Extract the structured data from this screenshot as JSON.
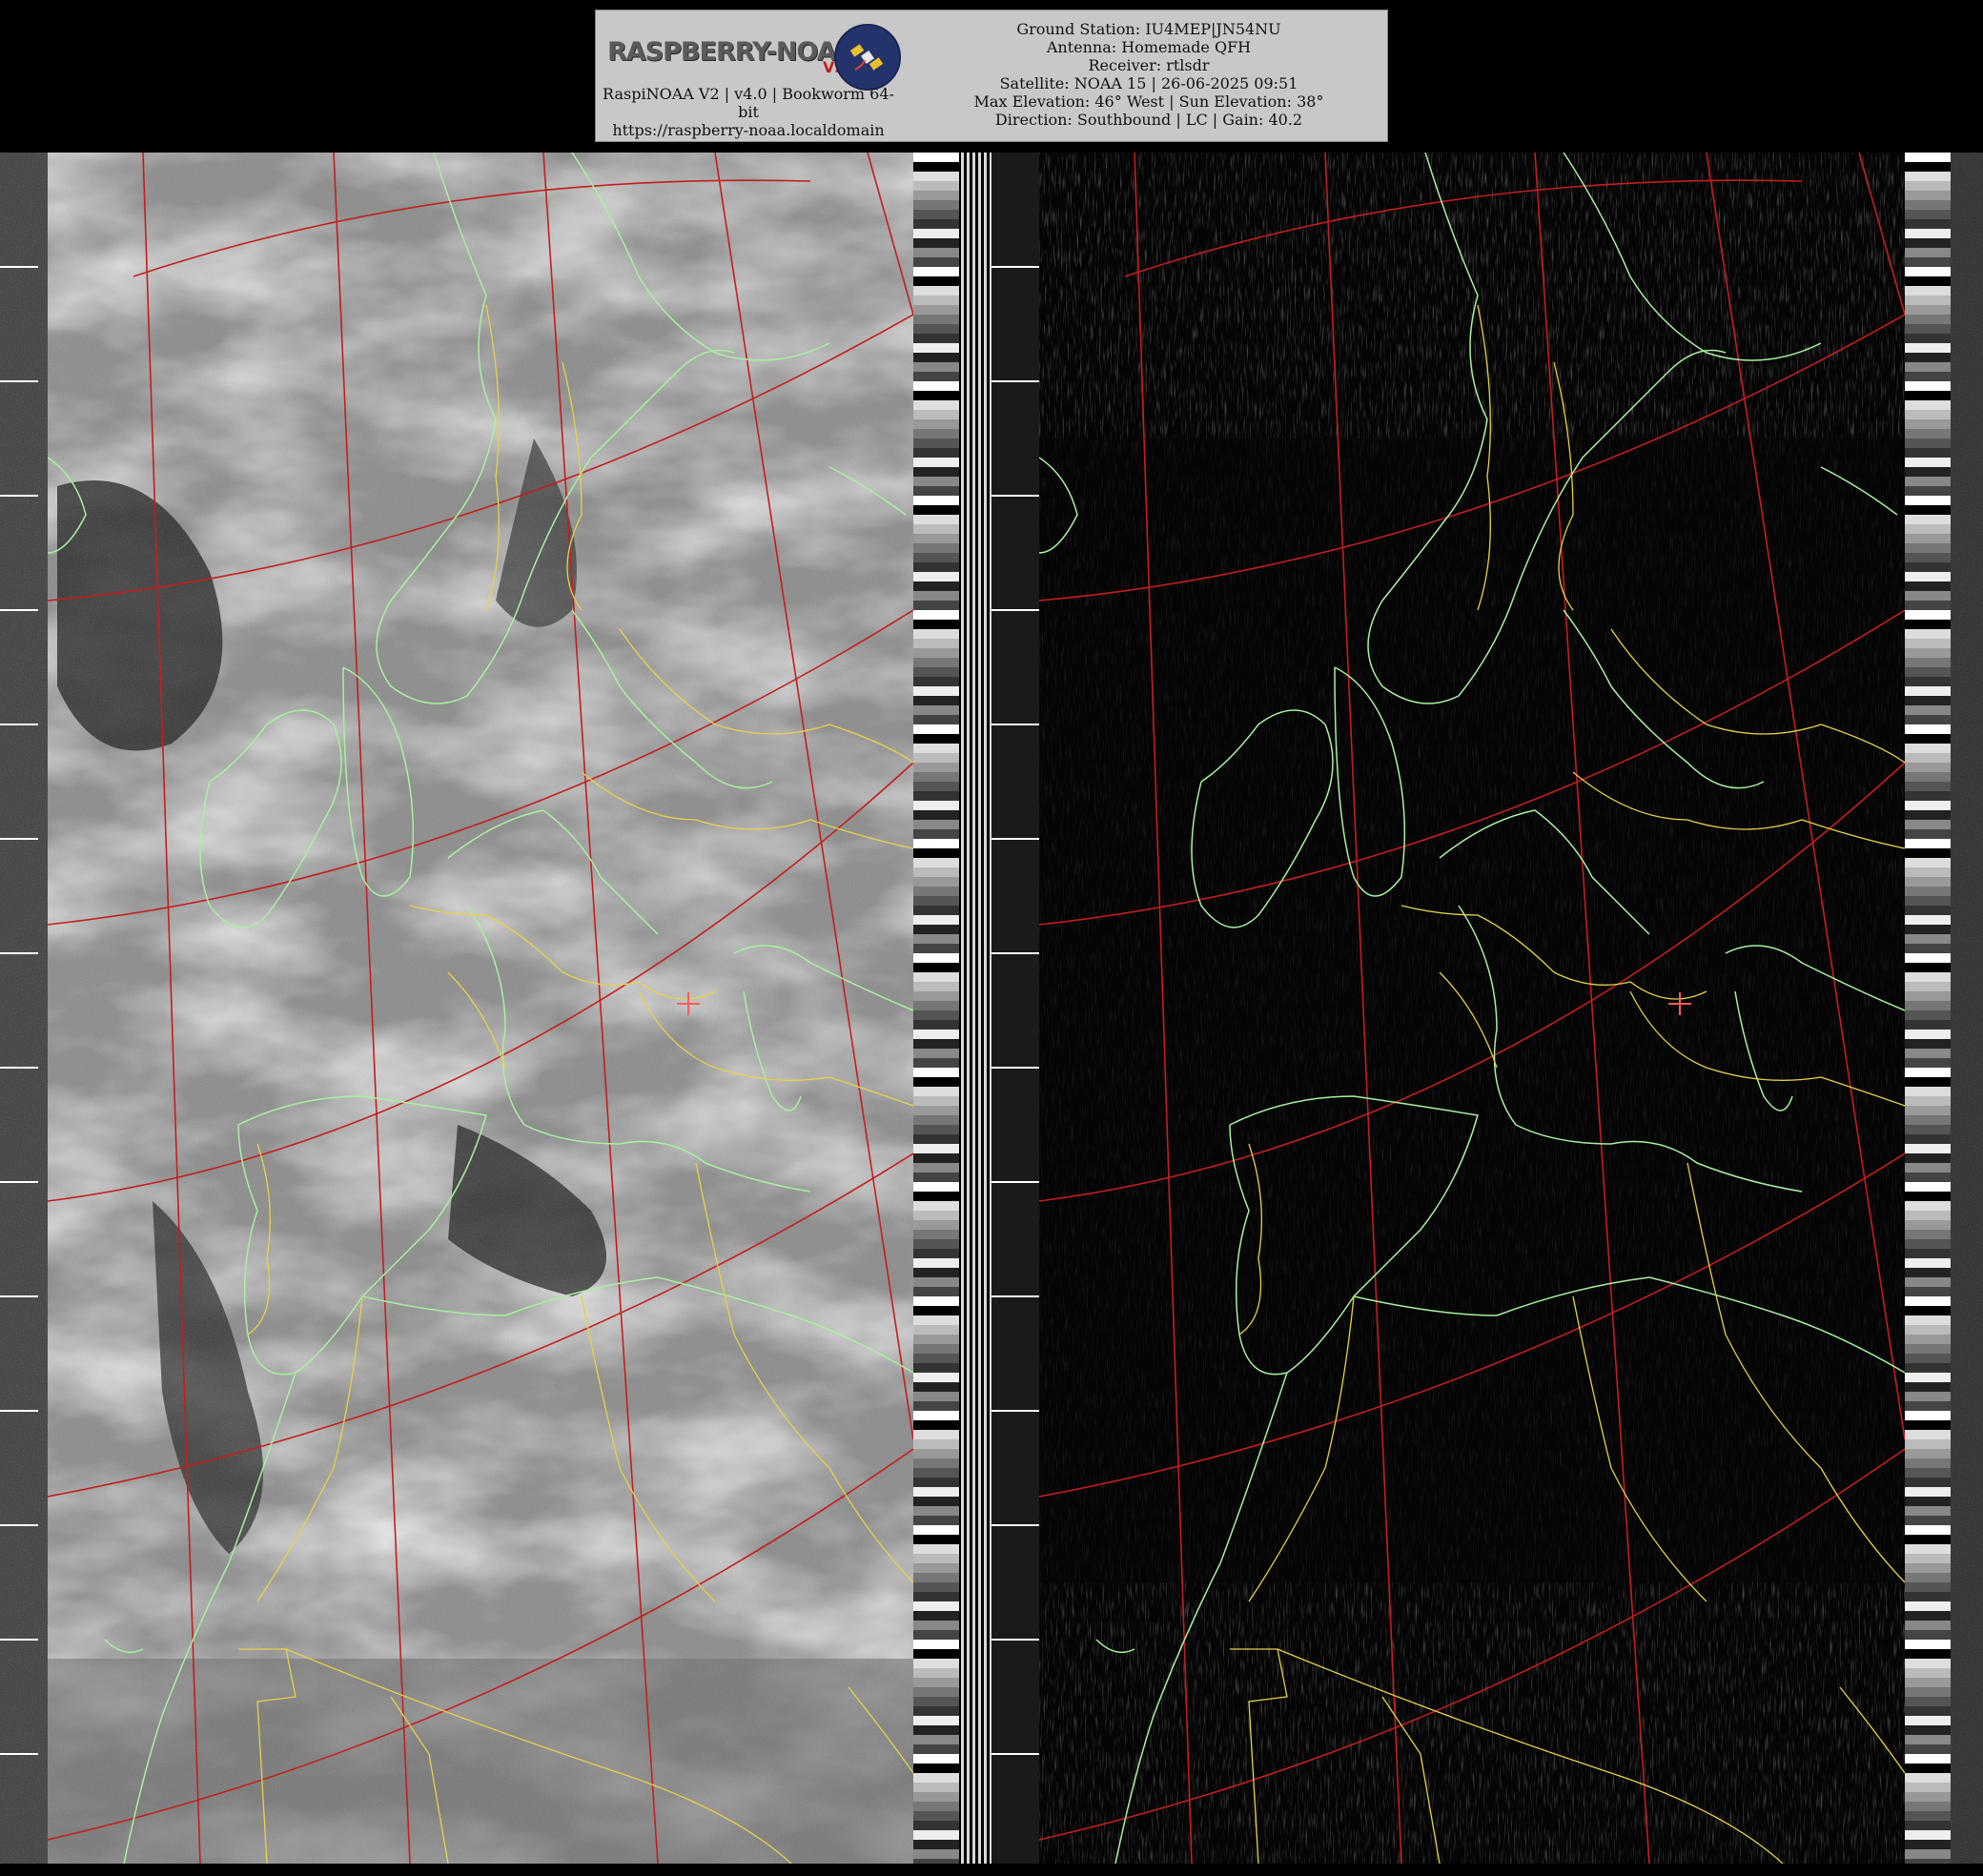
{
  "logo": {
    "wordmark": "RASPBERRY-NOAA",
    "version_badge": "V2"
  },
  "caption": {
    "line1": "RaspiNOAA V2 | v4.0 | Bookworm 64-",
    "line2": "bit",
    "url": "https://raspberry-noaa.localdomain"
  },
  "station": {
    "ground_station": "Ground Station: IU4MEP|JN54NU",
    "antenna": "Antenna: Homemade QFH",
    "receiver": "Receiver: rtlsdr",
    "satellite": "Satellite: NOAA 15 | 26-06-2025 09:51",
    "elevation": "Max Elevation: 46° West | Sun Elevation: 38°",
    "direction": "Direction: Southbound | LC | Gain: 40.2"
  },
  "colors": {
    "coastline": "#a8f0a0",
    "borders": "#e6d24a",
    "graticule": "#c41e1e",
    "marker": "#ff5a5a",
    "header_bg": "#c8c8c8"
  },
  "panels": [
    {
      "channel": "visible",
      "tone": "light"
    },
    {
      "channel": "infrared",
      "tone": "dark"
    }
  ]
}
